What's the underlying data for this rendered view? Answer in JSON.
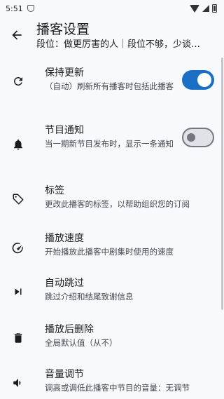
{
  "status_bar": {
    "time": "5:51"
  },
  "app_bar": {
    "title": "播客设置",
    "subtitle": "段位：做更厉害的人｜段位不够，少谈…"
  },
  "settings": [
    {
      "label": "保持更新",
      "desc": "（自动）刷新所有播客时包括此播客",
      "switch": true,
      "icon": "refresh-icon"
    },
    {
      "label": "节目通知",
      "desc": "当一期新节目发布时，显示一条通知",
      "switch": false,
      "icon": "bell-icon"
    },
    {
      "label": "标签",
      "desc": "更改此播客的标签，以帮助组织您的订阅",
      "icon": "tag-icon"
    },
    {
      "label": "播放速度",
      "desc": "开始播放此播客中剧集时使用的速度",
      "icon": "speed-icon"
    },
    {
      "label": "自动跳过",
      "desc": "跳过介绍和结尾致谢信息",
      "icon": "skip-icon"
    },
    {
      "label": "播放后删除",
      "desc": "全局默认值（从不）",
      "icon": "trash-icon"
    },
    {
      "label": "音量调节",
      "desc": "调高或调低此播客中节目的音量：无调节",
      "icon": "volume-icon"
    }
  ]
}
